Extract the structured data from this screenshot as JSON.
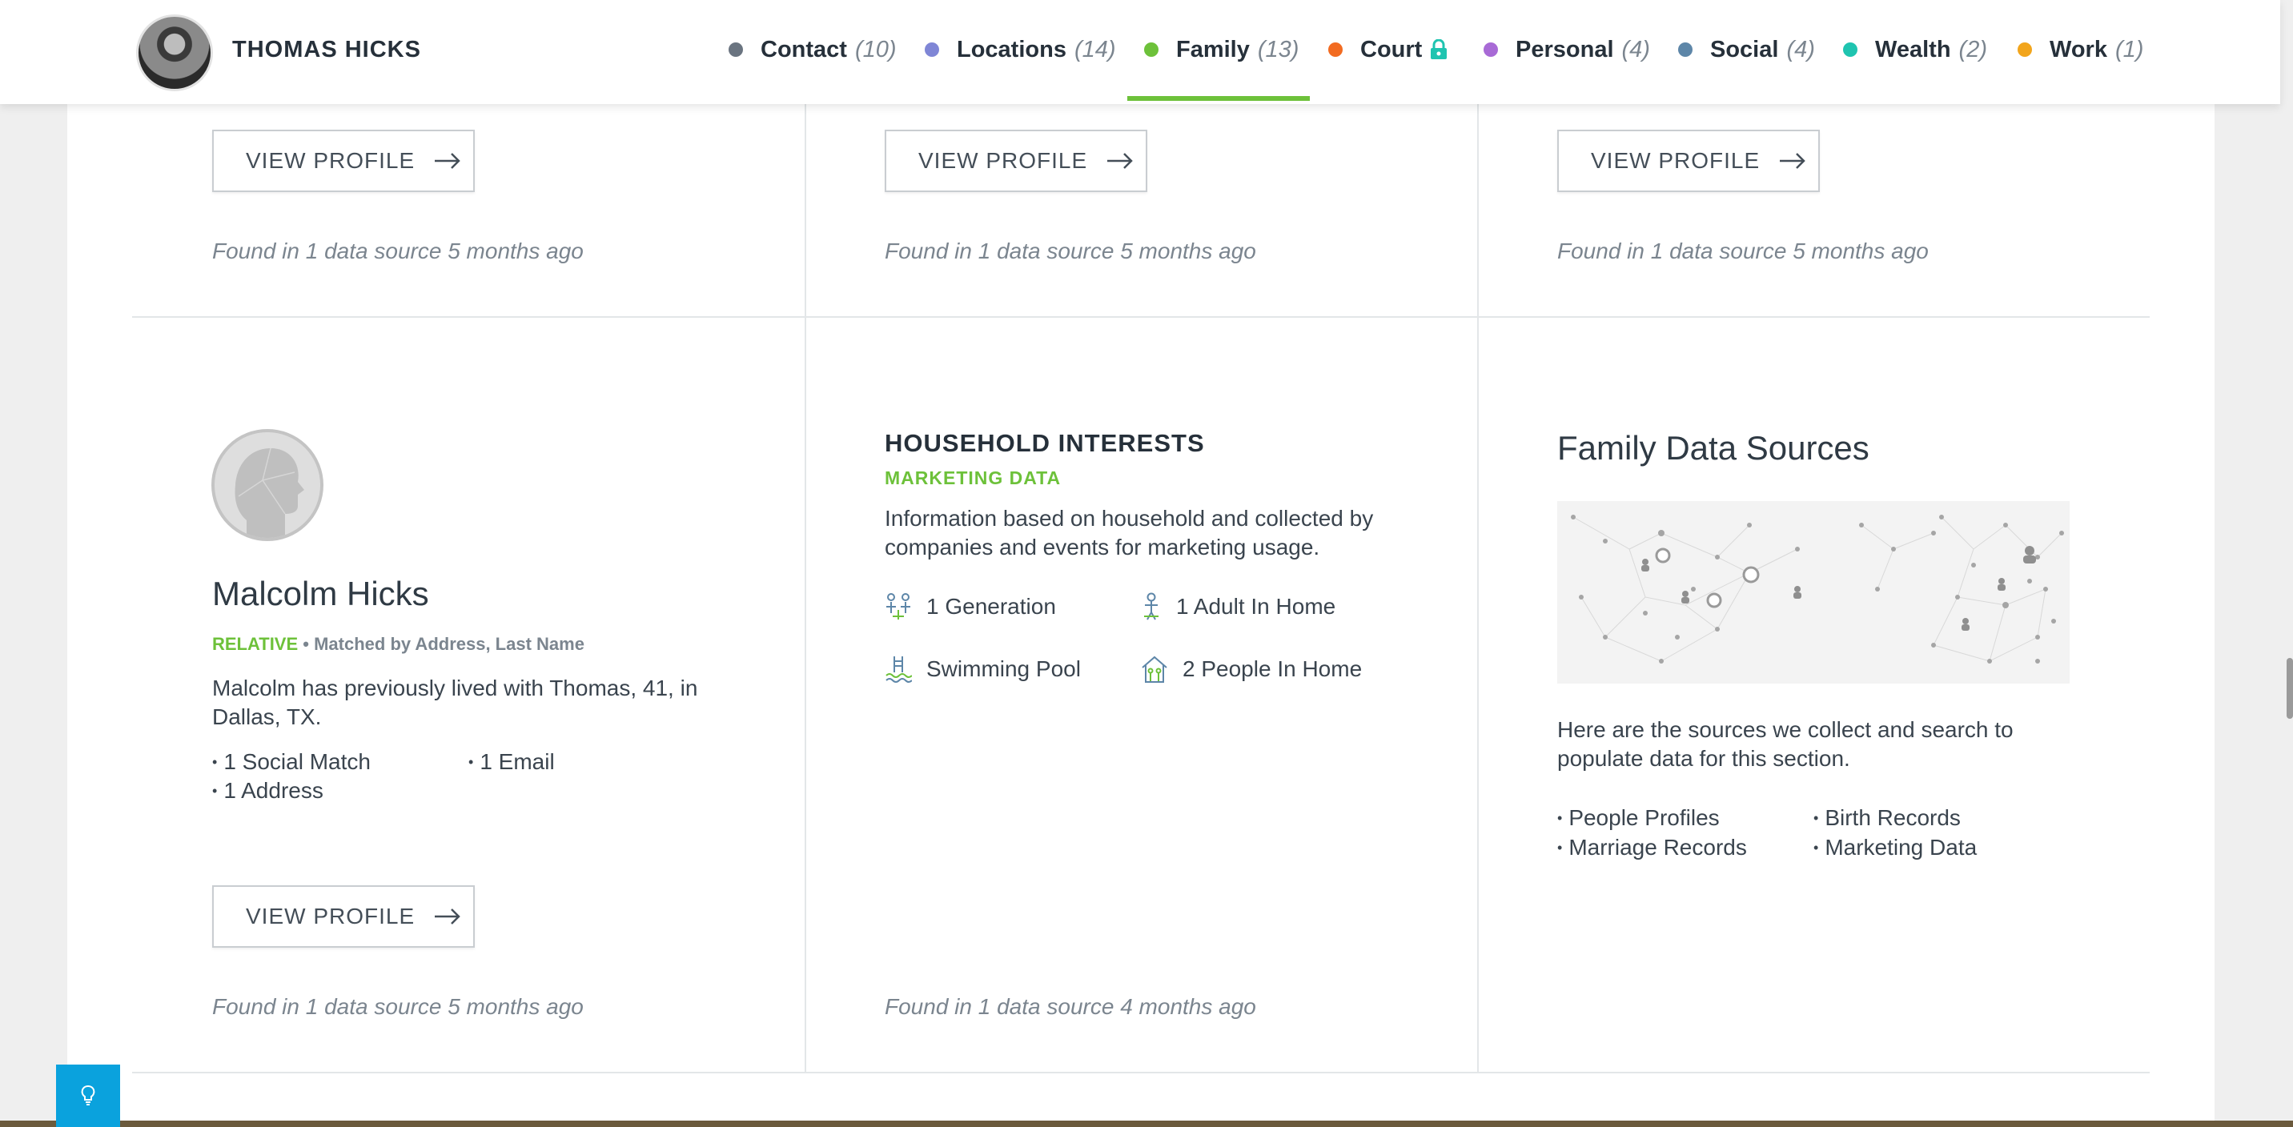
{
  "header": {
    "person_name": "THOMAS HICKS",
    "tabs": [
      {
        "label": "Contact",
        "count": "(10)",
        "color": "#6a7480",
        "active": false
      },
      {
        "label": "Locations",
        "count": "(14)",
        "color": "#7f86d6",
        "active": false
      },
      {
        "label": "Family",
        "count": "(13)",
        "color": "#6dc13a",
        "active": true
      },
      {
        "label": "Court",
        "count": "",
        "color": "#f26b21",
        "active": false,
        "icon": "lock-icon"
      },
      {
        "label": "Personal",
        "count": "(4)",
        "color": "#a86ad6",
        "active": false
      },
      {
        "label": "Social",
        "count": "(4)",
        "color": "#5d86a8",
        "active": false
      },
      {
        "label": "Wealth",
        "count": "(2)",
        "color": "#1fc4b0",
        "active": false
      },
      {
        "label": "Work",
        "count": "(1)",
        "color": "#f2a51c",
        "active": false
      }
    ]
  },
  "buttons": {
    "view_profile": "VIEW PROFILE"
  },
  "top_row": {
    "found": [
      "Found in 1 data source 5 months ago",
      "Found in 1 data source 5 months ago",
      "Found in 1 data source 5 months ago"
    ]
  },
  "relative": {
    "name": "Malcolm Hicks",
    "type": "RELATIVE",
    "separator": "•",
    "matched": "Matched by Address, Last Name",
    "description": "Malcolm has previously lived with Thomas, 41, in Dallas, TX.",
    "items": [
      "1 Social Match",
      "1 Email",
      "1 Address"
    ],
    "found": "Found in 1 data source 5 months ago"
  },
  "household": {
    "title": "HOUSEHOLD INTERESTS",
    "subtitle": "MARKETING DATA",
    "description": "Information based on household and collected by companies and events for marketing usage.",
    "items": [
      {
        "label": "1 Generation",
        "icon": "generation-icon"
      },
      {
        "label": "1 Adult In Home",
        "icon": "adult-icon"
      },
      {
        "label": "Swimming Pool",
        "icon": "pool-icon"
      },
      {
        "label": "2 People In Home",
        "icon": "house-people-icon"
      }
    ],
    "found": "Found in 1 data source 4 months ago"
  },
  "sources": {
    "title": "Family Data Sources",
    "description": "Here are the sources we collect and search to populate data for this section.",
    "items": [
      "People Profiles",
      "Birth Records",
      "Marriage Records",
      "Marketing Data"
    ]
  },
  "colors": {
    "accent_green": "#6dc13a",
    "help_blue": "#0aa2dd"
  }
}
